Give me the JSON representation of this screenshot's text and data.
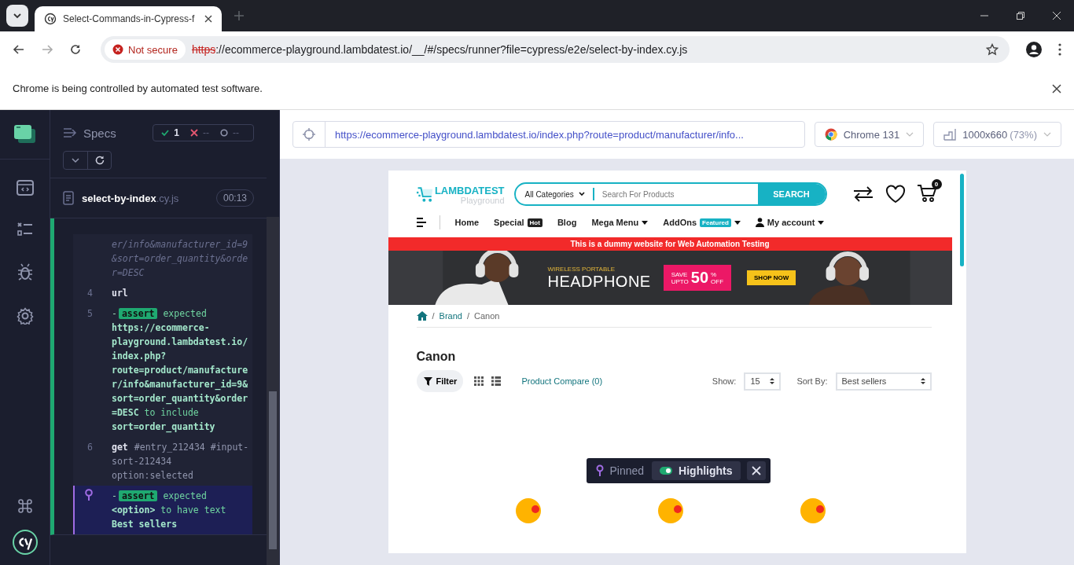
{
  "browser": {
    "tabs": [
      {
        "title": "Select-Commands-in-Cypress-f",
        "selected": true
      }
    ],
    "address": {
      "security": "Not secure",
      "scheme": "https",
      "rest": "://ecommerce-playground.lambdatest.io/__/#/specs/runner?file=cypress/e2e/select-by-index.cy.js"
    },
    "infobar": "Chrome is being controlled by automated test software."
  },
  "specs_panel": {
    "title": "Specs",
    "passed": "1",
    "failed": "--",
    "pending": "--",
    "spec": {
      "name": "select-by-index",
      "ext": ".cy.js",
      "duration": "00:13"
    },
    "commands": [
      {
        "kind": "continuation",
        "text": "er/info&manufacturer_id=9&sort=order_quantity&order=DESC",
        "pinned": false
      },
      {
        "kind": "command",
        "number": "4",
        "name": "url",
        "pinned": false
      },
      {
        "kind": "assert",
        "number": "5",
        "prefix": "-",
        "badge": "assert",
        "expected": "expected",
        "subject": "https://ecommerce-playground.lambdatest.io/index.php?route=product/manufacturer/info&manufacturer_id=9&sort=order_quantity&order=DESC",
        "verb": "to include",
        "value": "sort=order_quantity",
        "pinned": false
      },
      {
        "kind": "command",
        "number": "6",
        "name": "get",
        "message": "#entry_212434 #input-sort-212434 option:selected",
        "pinned": false
      },
      {
        "kind": "assert",
        "prefix": "-",
        "badge": "assert",
        "expected": "expected",
        "subject": "<option>",
        "verb": "to have text",
        "value": "Best sellers",
        "pinned": true
      }
    ]
  },
  "runner": {
    "url": "https://ecommerce-playground.lambdatest.io/index.php?route=product/manufacturer/info...",
    "browser": "Chrome 131",
    "viewport": "1000x660",
    "scale": "(73%)"
  },
  "site": {
    "logo": {
      "name": "LAMBDATEST",
      "sub": "Playground"
    },
    "search": {
      "category": "All Categories",
      "placeholder": "Search For Products",
      "button": "SEARCH"
    },
    "cart_count": "0",
    "menu": [
      {
        "label": "Home",
        "dropdown": false
      },
      {
        "label": "Special",
        "badge": "Hot",
        "kind": "dark",
        "dropdown": false
      },
      {
        "label": "Blog",
        "dropdown": false
      },
      {
        "label": "Mega Menu",
        "dropdown": true
      },
      {
        "label": "AddOns",
        "badge": "Featured",
        "kind": "teal",
        "dropdown": true
      },
      {
        "label": "My account",
        "kind": "account",
        "dropdown": true
      }
    ],
    "notice": "This is a dummy website for Web Automation Testing",
    "banner": {
      "kind": "picture",
      "kicker": "WIRELESS PORTABLE",
      "headline": "HEADPHONE",
      "save": "SAVE",
      "upto": "UPTO",
      "percent": "50",
      "sign": "%",
      "off": "OFF",
      "cta": "SHOP NOW"
    },
    "breadcrumb": [
      {
        "separator": "/",
        "label": "Brand"
      },
      {
        "separator": "/",
        "label": "Canon"
      }
    ],
    "heading": "Canon",
    "toolbar": {
      "filter": "Filter",
      "compare": "Product Compare (0)",
      "show_label": "Show:",
      "show_value": "15",
      "sort_label": "Sort By:",
      "sort_value": "Best sellers"
    }
  },
  "overlay": {
    "pinned": "Pinned",
    "highlights": {
      "label": "Highlights",
      "on": true
    }
  }
}
